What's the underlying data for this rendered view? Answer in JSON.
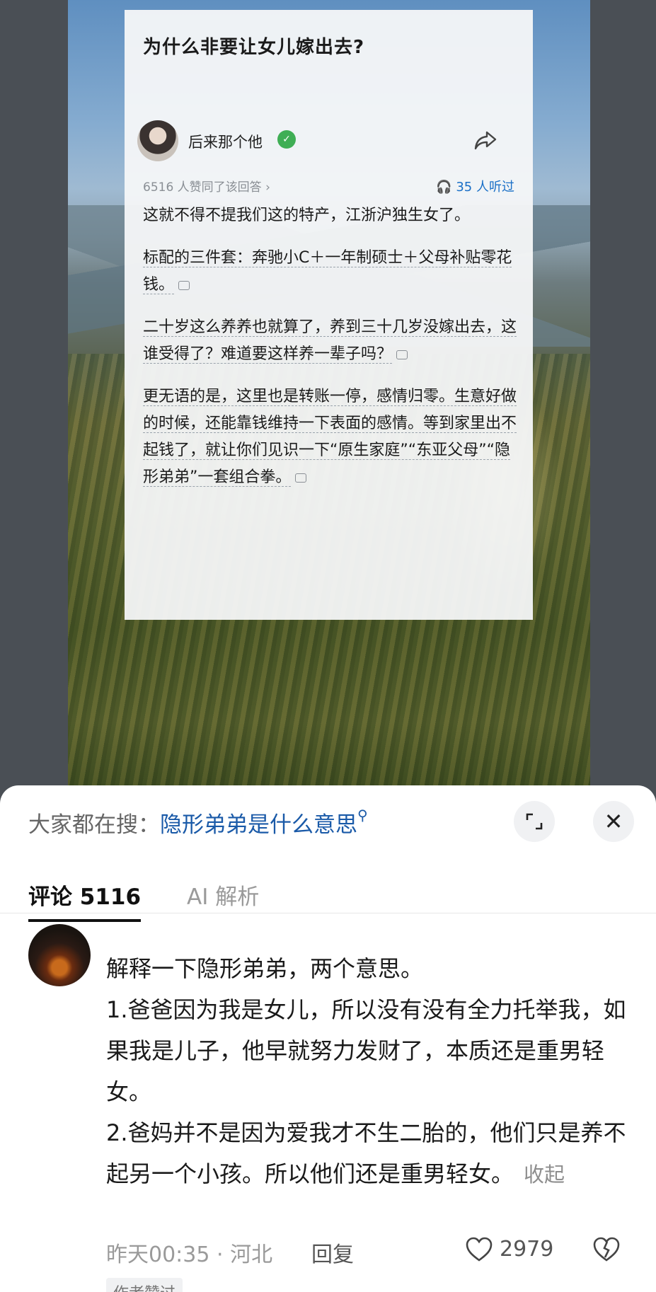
{
  "question": {
    "title": "为什么非要让女儿嫁出去?"
  },
  "answer": {
    "author": "后来那个他",
    "likes_line": "6516 人赞同了该回答 ›",
    "listened": "35 人听过",
    "paragraphs": [
      "这就不得不提我们这的特产，江浙沪独生女了。",
      "标配的三件套：奔驰小C＋一年制硕士＋父母补贴零花钱。",
      "二十岁这么养养也就算了，养到三十几岁没嫁出去，这谁受得了？难道要这样养一辈子吗？",
      "更无语的是，这里也是转账一停，感情归零。生意好做的时候，还能靠钱维持一下表面的感情。等到家里出不起钱了，就让你们见识一下“原生家庭”“东亚父母”“隐形弟弟”一套组合拳。"
    ]
  },
  "sheet": {
    "search_label": "大家都在搜：",
    "search_term": "隐形弟弟是什么意思",
    "close_symbol": "✕",
    "tabs": {
      "comments": "评论 5116",
      "ai": "AI 解析"
    },
    "comment": {
      "lines": [
        "解释一下隐形弟弟，两个意思。",
        "1.爸爸因为我是女儿，所以没有没有全力托举我，如果我是儿子，他早就努力发财了，本质还是重男轻女。",
        "2.爸妈并不是因为爱我才不生二胎的，他们只是养不起另一个小孩。所以他们还是重男轻女。"
      ],
      "collapse": "收起",
      "time_location": "昨天00:35 · 河北",
      "reply": "回复",
      "like_count": "2979",
      "author_liked": "作者赞过"
    }
  },
  "colors": {
    "link_blue": "#1a5aa8",
    "listen_blue": "#1a6fc7",
    "verified_green": "#3fae55"
  },
  "icons": [
    "share-icon",
    "verified-icon",
    "headphones-icon",
    "comment-bubble-icon",
    "search-icon",
    "expand-icon",
    "close-icon",
    "heart-icon",
    "broken-heart-icon"
  ]
}
